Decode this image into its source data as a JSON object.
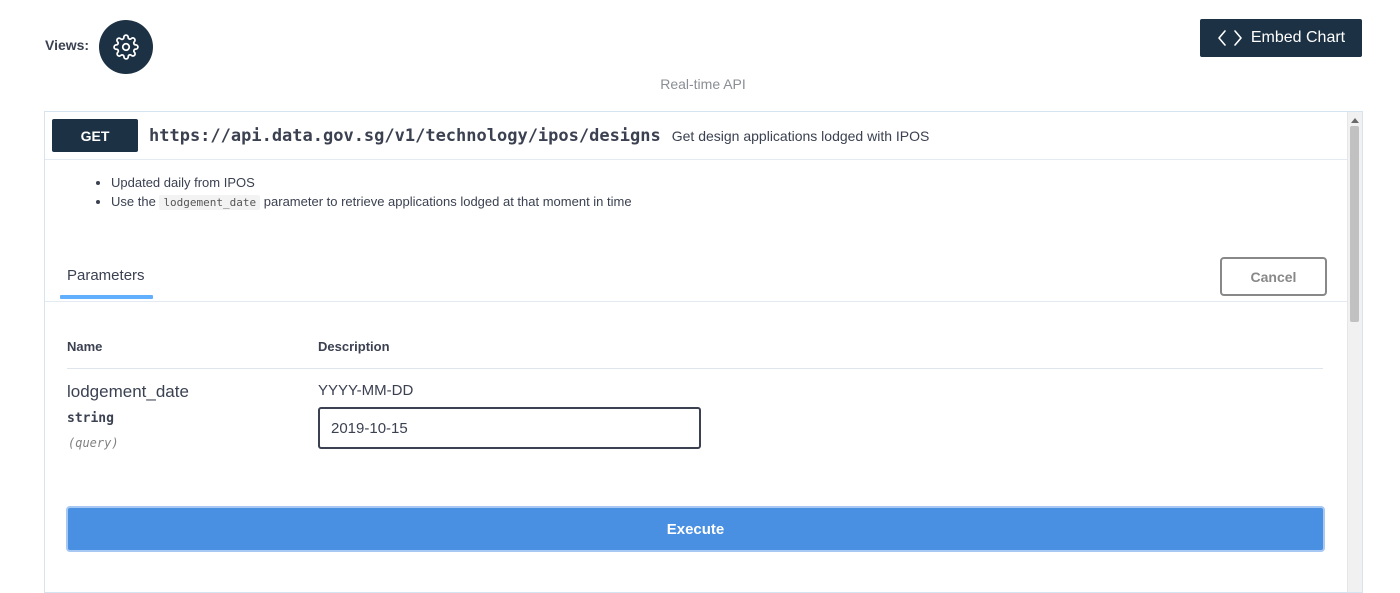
{
  "views": {
    "label": "Views:",
    "icon": "gear-icon"
  },
  "embed": {
    "label": "Embed Chart",
    "icon": "code-icon"
  },
  "section": {
    "caption": "Real-time API"
  },
  "operation": {
    "method": "GET",
    "path": "https://api.data.gov.sg/v1/technology/ipos/designs",
    "summary": "Get design applications lodged with IPOS",
    "description": {
      "line1": "Updated daily from IPOS",
      "line2_prefix": "Use the",
      "line2_code": "lodgement_date",
      "line2_suffix": "parameter to retrieve applications lodged at that moment in time"
    }
  },
  "parameters": {
    "tab_label": "Parameters",
    "cancel_label": "Cancel",
    "columns": {
      "name": "Name",
      "description": "Description"
    },
    "items": [
      {
        "name": "lodgement_date",
        "type": "string",
        "in": "(query)",
        "format": "YYYY-MM-DD",
        "value": "2019-10-15"
      }
    ]
  },
  "execute": {
    "label": "Execute"
  },
  "colors": {
    "dark_navy": "#1c3144",
    "execute_blue": "#4990e2",
    "tab_underline": "#61affe"
  }
}
